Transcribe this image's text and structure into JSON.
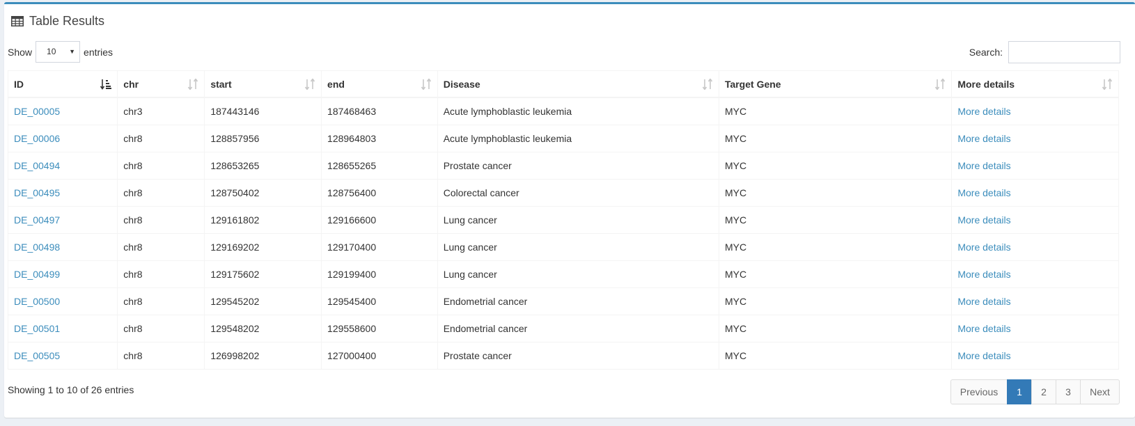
{
  "header": {
    "title": "Table Results",
    "icon": "table-icon"
  },
  "length": {
    "show_label": "Show",
    "selected": "10",
    "entries_label": "entries"
  },
  "search": {
    "label": "Search:",
    "value": ""
  },
  "table": {
    "columns": [
      "ID",
      "chr",
      "start",
      "end",
      "Disease",
      "Target Gene",
      "More details"
    ],
    "rows": [
      [
        "DE_00005",
        "chr3",
        "187443146",
        "187468463",
        "Acute lymphoblastic leukemia",
        "MYC",
        "More details"
      ],
      [
        "DE_00006",
        "chr8",
        "128857956",
        "128964803",
        "Acute lymphoblastic leukemia",
        "MYC",
        "More details"
      ],
      [
        "DE_00494",
        "chr8",
        "128653265",
        "128655265",
        "Prostate cancer",
        "MYC",
        "More details"
      ],
      [
        "DE_00495",
        "chr8",
        "128750402",
        "128756400",
        "Colorectal cancer",
        "MYC",
        "More details"
      ],
      [
        "DE_00497",
        "chr8",
        "129161802",
        "129166600",
        "Lung cancer",
        "MYC",
        "More details"
      ],
      [
        "DE_00498",
        "chr8",
        "129169202",
        "129170400",
        "Lung cancer",
        "MYC",
        "More details"
      ],
      [
        "DE_00499",
        "chr8",
        "129175602",
        "129199400",
        "Lung cancer",
        "MYC",
        "More details"
      ],
      [
        "DE_00500",
        "chr8",
        "129545202",
        "129545400",
        "Endometrial cancer",
        "MYC",
        "More details"
      ],
      [
        "DE_00501",
        "chr8",
        "129548202",
        "129558600",
        "Endometrial cancer",
        "MYC",
        "More details"
      ],
      [
        "DE_00505",
        "chr8",
        "126998202",
        "127000400",
        "Prostate cancer",
        "MYC",
        "More details"
      ]
    ]
  },
  "footer": {
    "info": "Showing 1 to 10 of 26 entries",
    "pagination": {
      "previous": "Previous",
      "pages": [
        "1",
        "2",
        "3"
      ],
      "active": "1",
      "next": "Next"
    }
  },
  "colors": {
    "accent": "#3c8dbc",
    "active_page": "#337ab7",
    "link": "#3c8dbc"
  }
}
